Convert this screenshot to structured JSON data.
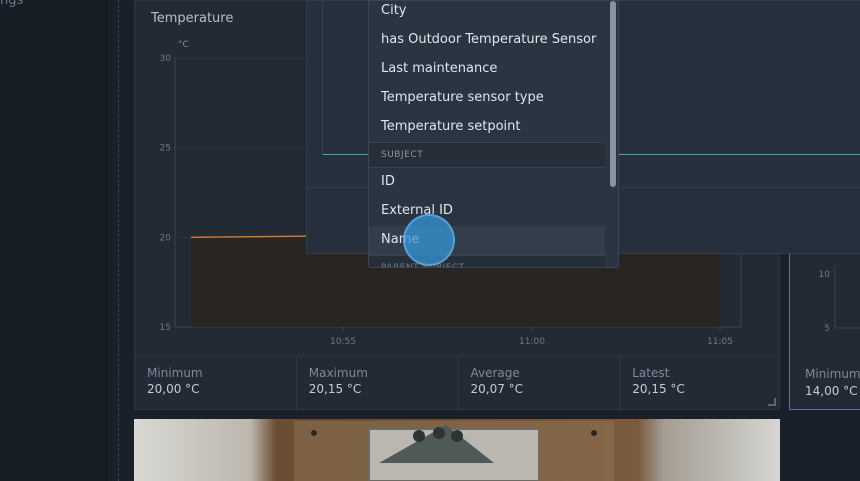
{
  "sidebar": {
    "fragment_text": "ngs"
  },
  "temperature_card": {
    "title": "Temperature",
    "unit_label": "°C",
    "stats": [
      {
        "label": "Minimum",
        "value": "20,00 °C"
      },
      {
        "label": "Maximum",
        "value": "20,15 °C"
      },
      {
        "label": "Average",
        "value": "20,07 °C"
      },
      {
        "label": "Latest",
        "value": "20,15 °C"
      }
    ]
  },
  "chart_data": {
    "type": "area",
    "title": "Temperature",
    "ylabel": "°C",
    "ylim": [
      15,
      30
    ],
    "yticks": [
      "30",
      "25",
      "20",
      "15"
    ],
    "xticks": [
      "10:55",
      "11:00",
      "11:05"
    ],
    "grid": true,
    "series": [
      {
        "name": "",
        "values": [
          20.0,
          20.1,
          20.15,
          20.15
        ],
        "color": "#d97a2e"
      }
    ]
  },
  "second_card": {
    "yticks": [
      "10",
      "5"
    ],
    "stat_label": "Minimum",
    "stat_value": "14,00 °C",
    "border_color": "#6a62c9"
  },
  "dropdown": {
    "items_top": [
      "City",
      "has Outdoor Temperature Sensor",
      "Last maintenance",
      "Temperature sensor type",
      "Temperature setpoint"
    ],
    "section_subject": "SUBJECT",
    "subject_items": [
      "ID",
      "External ID",
      "Name"
    ],
    "section_parent": "PARENT SUBJECT",
    "hovered_item": "Name"
  },
  "colors": {
    "accent_green": "#3fb187",
    "series_orange": "#d97a2e",
    "touch_blue": "#3498db"
  }
}
